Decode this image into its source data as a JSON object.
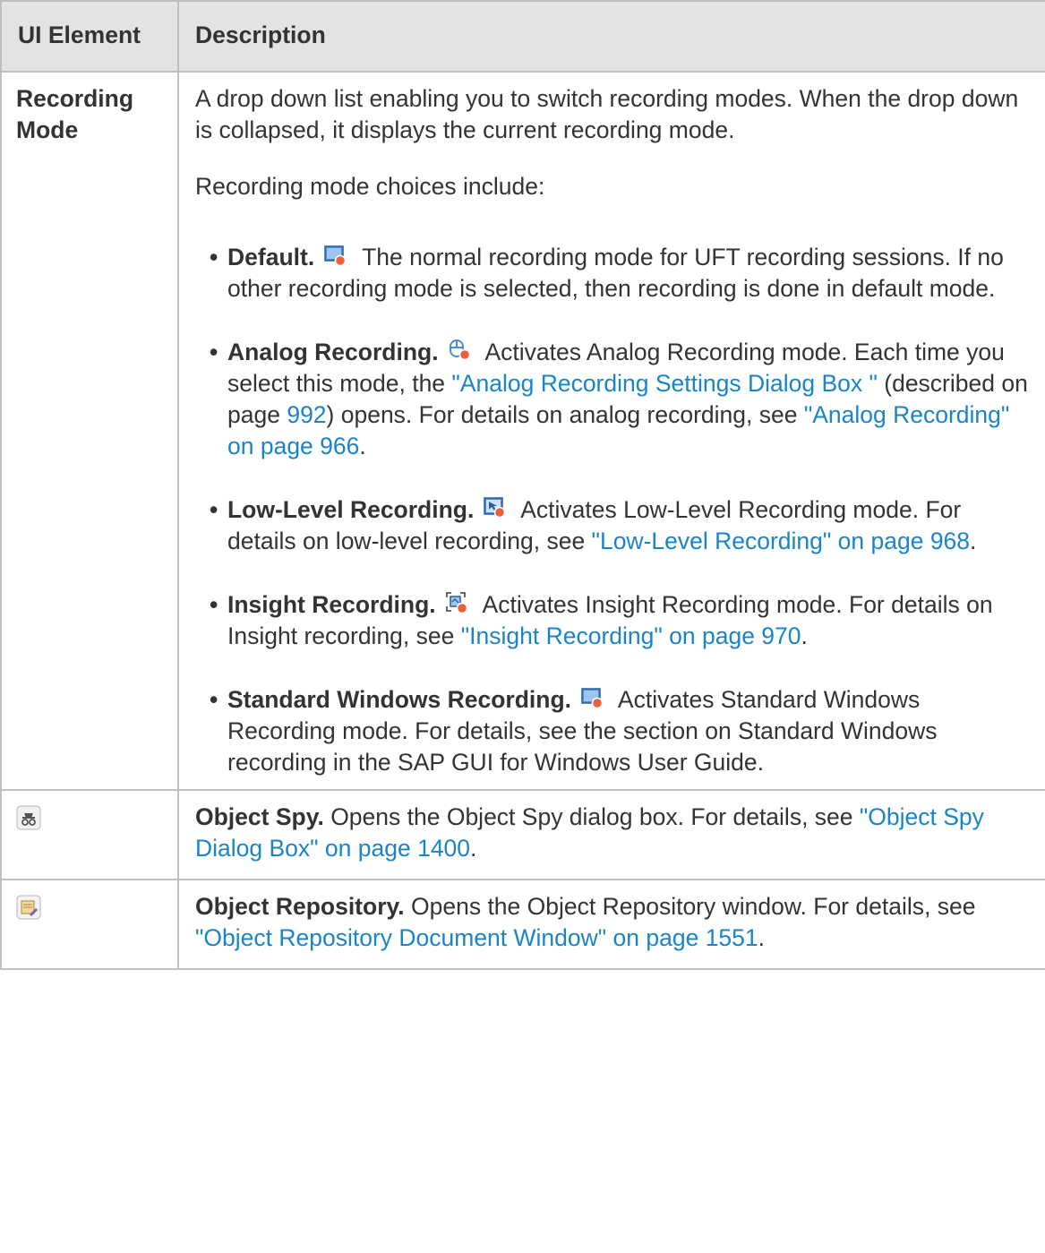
{
  "table": {
    "header": {
      "col1": "UI Element",
      "col2": "Description"
    },
    "recording_mode": {
      "element": "Recording Mode",
      "intro": "A drop down list enabling you to switch recording modes. When the drop down is collapsed, it displays the current recording mode.",
      "choices_label": "Recording mode choices include:",
      "modes": [
        {
          "name": "Default.",
          "icon": "default-recording-icon",
          "text": " The normal recording mode for UFT recording sessions. If no other recording mode is selected, then recording is done in default mode."
        },
        {
          "name": "Analog Recording.",
          "icon": "analog-recording-icon",
          "text_a": " Activates Analog Recording mode. Each time you select this mode, the ",
          "link_a": "\"Analog Recording Settings Dialog Box \"",
          "text_b": " (described on page ",
          "link_b": "992",
          "text_c": ") opens. For details on analog recording, see ",
          "link_c": "\"Analog Recording\" on page 966",
          "text_d": "."
        },
        {
          "name": "Low-Level Recording.",
          "icon": "low-level-recording-icon",
          "text_a": " Activates Low-Level Recording mode. For details on low-level recording, see ",
          "link_a": "\"Low-Level Recording\" on page 968",
          "text_b": "."
        },
        {
          "name": "Insight Recording.",
          "icon": "insight-recording-icon",
          "text_a": " Activates Insight Recording mode. For details on Insight recording, see ",
          "link_a": "\"Insight Recording\" on page 970",
          "text_b": "."
        },
        {
          "name": "Standard Windows Recording.",
          "icon": "standard-windows-recording-icon",
          "text": " Activates Standard Windows Recording mode. For details, see the section on Standard Windows recording in the SAP GUI for Windows User Guide."
        }
      ]
    },
    "object_spy": {
      "icon": "object-spy-icon",
      "name": "Object Spy.",
      "text": " Opens the Object Spy dialog box. For details, see ",
      "link": "\"Object Spy Dialog Box\" on page 1400",
      "end": "."
    },
    "object_repository": {
      "icon": "object-repository-icon",
      "name": "Object Repository.",
      "text": " Opens the Object Repository window. For details, see ",
      "link": "\"Object Repository Document Window\" on page 1551",
      "end": "."
    },
    "colors": {
      "link": "#1a85c6",
      "header_bg": "#e3e3e3",
      "border": "#bfbfbf",
      "text": "#333333"
    }
  }
}
